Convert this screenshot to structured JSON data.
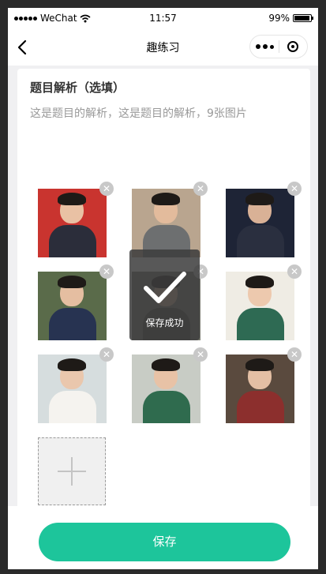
{
  "status_bar": {
    "carrier": "WeChat",
    "time": "11:57",
    "battery": "99%"
  },
  "nav": {
    "title": "趣练习",
    "back_icon": "chevron-left-icon",
    "more_icon": "more-dots-icon",
    "close_icon": "target-circle-icon"
  },
  "section": {
    "title": "题目解析（选填）",
    "analysis": "这是题目的解析，这是题目的解析，9张图片"
  },
  "images": [
    {
      "id": "photo-1",
      "colors": {
        "bg": "#c9342f",
        "skin": "#e9c1a4",
        "body": "#2b2d3a"
      }
    },
    {
      "id": "photo-2",
      "colors": {
        "bg": "#b9a58f",
        "skin": "#e3bb9c",
        "body": "#6d6f70"
      }
    },
    {
      "id": "photo-3",
      "colors": {
        "bg": "#1e2436",
        "skin": "#d9b196",
        "body": "#2a2f3f"
      }
    },
    {
      "id": "photo-4",
      "colors": {
        "bg": "#5a6b4a",
        "skin": "#e5bea1",
        "body": "#273351"
      }
    },
    {
      "id": "photo-5",
      "colors": {
        "bg": "#7b7c72",
        "skin": "#d9b49b",
        "body": "#4a4640"
      }
    },
    {
      "id": "photo-6",
      "colors": {
        "bg": "#efece4",
        "skin": "#edc9ae",
        "body": "#2e6a53"
      }
    },
    {
      "id": "photo-7",
      "colors": {
        "bg": "#d6ddde",
        "skin": "#eac7ad",
        "body": "#f5f3ef"
      }
    },
    {
      "id": "photo-8",
      "colors": {
        "bg": "#c8ccc5",
        "skin": "#e8c2a6",
        "body": "#2f6b4e"
      }
    },
    {
      "id": "photo-9",
      "colors": {
        "bg": "#5a4a3e",
        "skin": "#e4bfa4",
        "body": "#8c2f2d"
      }
    }
  ],
  "add_image": {
    "icon": "plus-icon"
  },
  "delete_icon": {
    "glyph": "✕"
  },
  "toast": {
    "text": "保存成功",
    "icon": "checkmark-icon"
  },
  "footer": {
    "save_label": "保存"
  },
  "colors": {
    "accent": "#1dc59b"
  }
}
